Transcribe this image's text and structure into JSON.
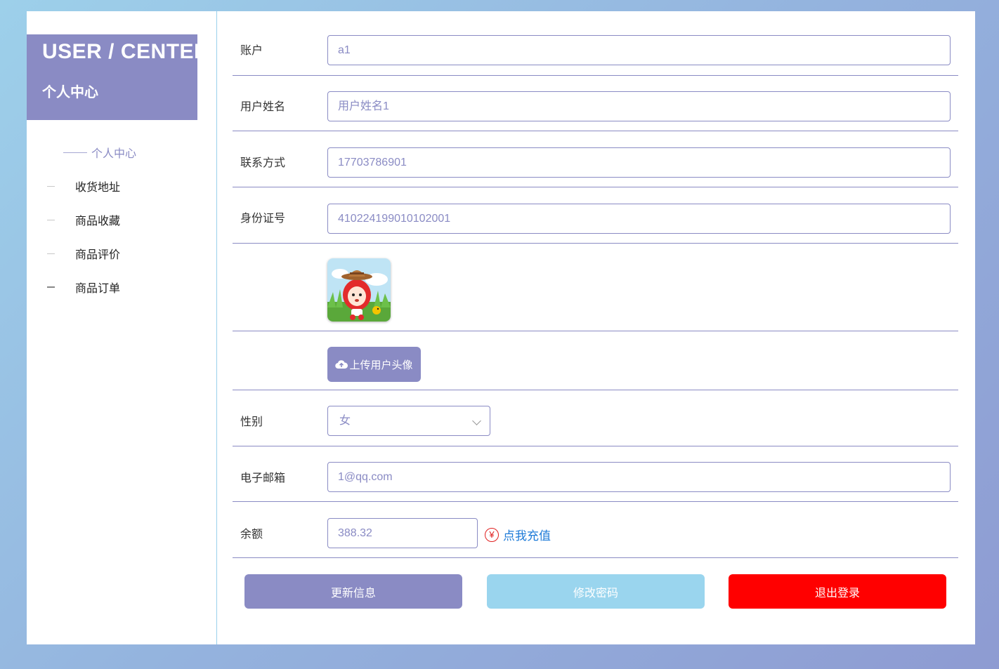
{
  "brand": {
    "title_en": "USER / CENTER",
    "title_zh": "个人中心"
  },
  "nav": {
    "active": "个人中心",
    "items": [
      {
        "label": "收货地址"
      },
      {
        "label": "商品收藏"
      },
      {
        "label": "商品评价"
      },
      {
        "label": "商品订单"
      }
    ]
  },
  "form": {
    "account": {
      "label": "账户",
      "value": "a1"
    },
    "username": {
      "label": "用户姓名",
      "value": "用户姓名1"
    },
    "phone": {
      "label": "联系方式",
      "value": "17703786901"
    },
    "idcard": {
      "label": "身份证号",
      "value": "410224199010102001"
    },
    "avatar": {
      "icon": "cartoon-avatar"
    },
    "upload": {
      "label": "上传用户头像",
      "icon": "cloud-upload-icon"
    },
    "gender": {
      "label": "性别",
      "value": "女"
    },
    "email": {
      "label": "电子邮箱",
      "value": "1@qq.com"
    },
    "balance": {
      "label": "余额",
      "value": "388.32",
      "recharge_label": "点我充值",
      "recharge_symbol": "¥"
    }
  },
  "actions": {
    "update": {
      "label": "更新信息",
      "color": "#8a8bc4"
    },
    "password": {
      "label": "修改密码",
      "color": "#9ad5ee"
    },
    "logout": {
      "label": "退出登录",
      "color": "#ff0000"
    }
  },
  "colors": {
    "accent": "#8a8bc4",
    "link": "#1e7bd8",
    "danger": "#ff0000"
  }
}
